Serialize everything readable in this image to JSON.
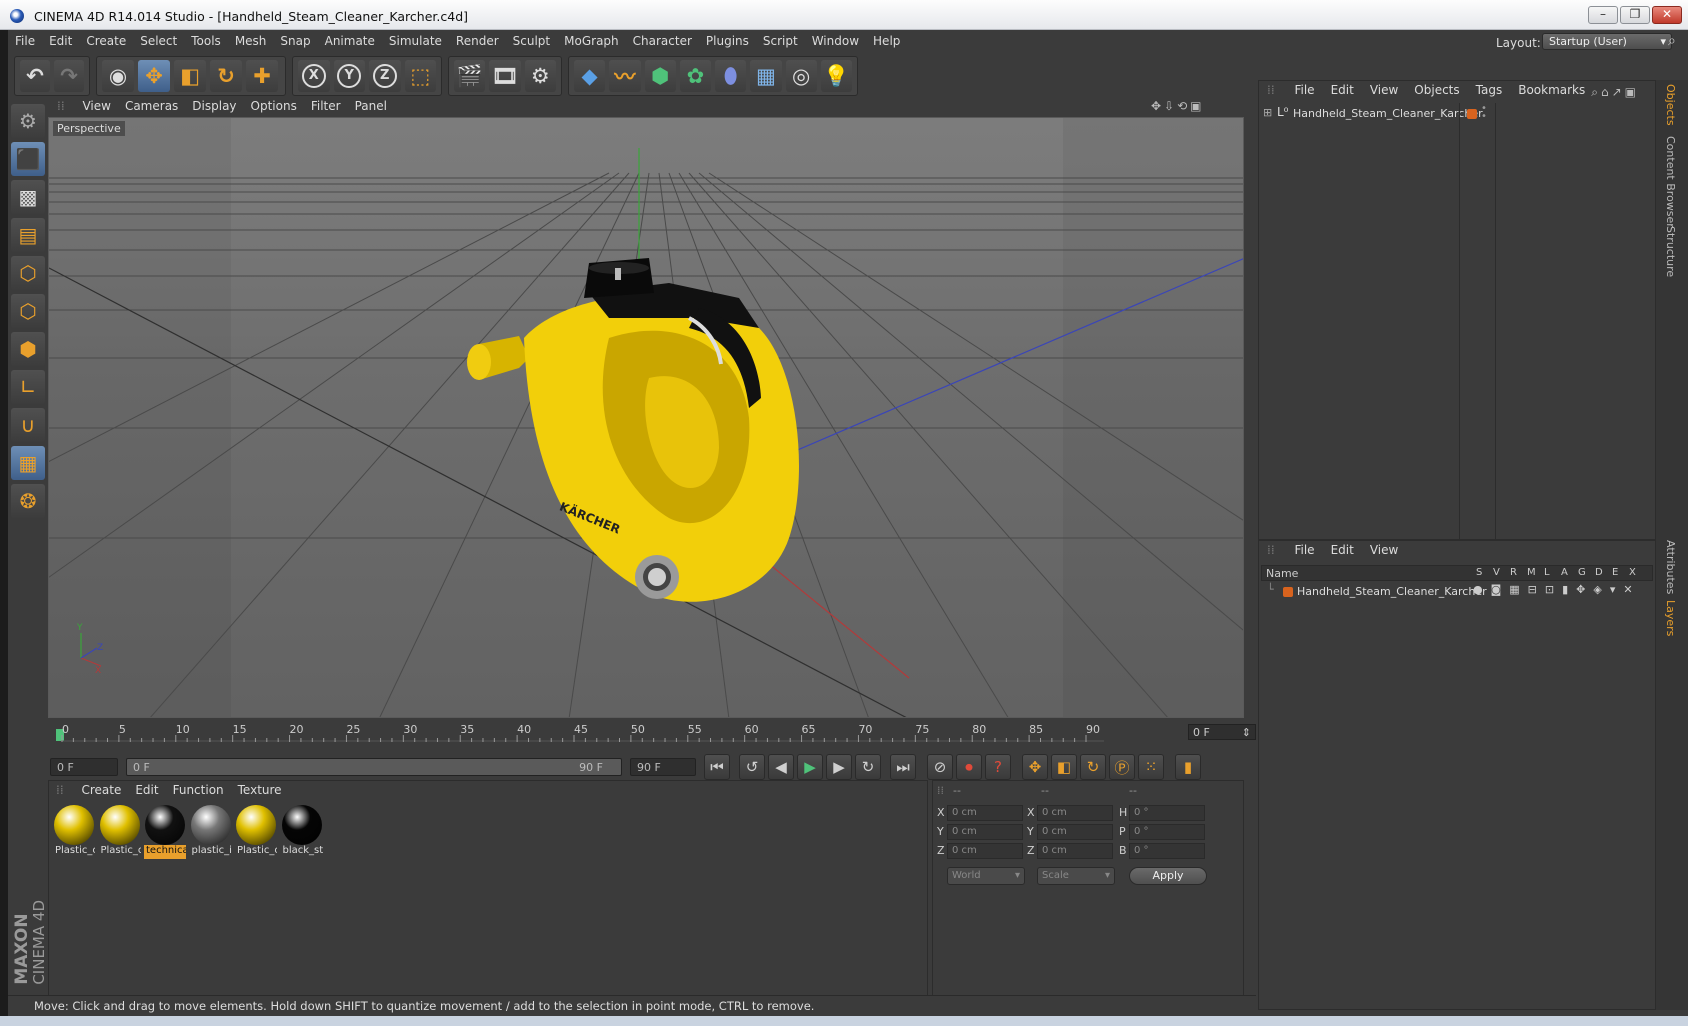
{
  "window": {
    "title": "CINEMA 4D R14.014 Studio - [Handheld_Steam_Cleaner_Karcher.c4d]",
    "buttons": {
      "min": "–",
      "max": "❐",
      "close": "✕"
    }
  },
  "menu": [
    "File",
    "Edit",
    "Create",
    "Select",
    "Tools",
    "Mesh",
    "Snap",
    "Animate",
    "Simulate",
    "Render",
    "Sculpt",
    "MoGraph",
    "Character",
    "Plugins",
    "Script",
    "Window",
    "Help"
  ],
  "layout": {
    "label": "Layout:",
    "value": "Startup (User)"
  },
  "viewport": {
    "menu": [
      "View",
      "Cameras",
      "Display",
      "Options",
      "Filter",
      "Panel"
    ],
    "label": "Perspective",
    "axes": {
      "y": "Y",
      "x": "X",
      "z": "Z"
    },
    "brand_text": "KÄRCHER"
  },
  "timeline": {
    "ticks": [
      "0",
      "5",
      "10",
      "15",
      "20",
      "25",
      "30",
      "35",
      "40",
      "45",
      "50",
      "55",
      "60",
      "65",
      "70",
      "75",
      "80",
      "85",
      "90"
    ],
    "current": "0 F",
    "start": "0 F",
    "range_start": "0 F",
    "range_end": "90 F",
    "end": "90 F"
  },
  "materials": {
    "menu": [
      "Create",
      "Edit",
      "Function",
      "Texture"
    ],
    "items": [
      {
        "name": "Plastic_c",
        "color": "#e0c000",
        "selected": false
      },
      {
        "name": "Plastic_c",
        "color": "#e0c000",
        "selected": false
      },
      {
        "name": "technica",
        "color": "#111111",
        "selected": true
      },
      {
        "name": "plastic_i",
        "color": "#777777",
        "selected": false
      },
      {
        "name": "Plastic_c",
        "color": "#e0c000",
        "selected": false
      },
      {
        "name": "black_st",
        "color": "#050505",
        "selected": false
      }
    ]
  },
  "coords": {
    "headers": [
      "--",
      "--",
      "--"
    ],
    "rows": [
      {
        "a": "X",
        "av": "0 cm",
        "b": "X",
        "bv": "0 cm",
        "c": "H",
        "cv": "0 °"
      },
      {
        "a": "Y",
        "av": "0 cm",
        "b": "Y",
        "bv": "0 cm",
        "c": "P",
        "cv": "0 °"
      },
      {
        "a": "Z",
        "av": "0 cm",
        "b": "Z",
        "bv": "0 cm",
        "c": "B",
        "cv": "0 °"
      }
    ],
    "space": "World",
    "mode": "Scale",
    "apply": "Apply"
  },
  "objects": {
    "menu": [
      "File",
      "Edit",
      "View",
      "Objects",
      "Tags",
      "Bookmarks"
    ],
    "item": "Handheld_Steam_Cleaner_Karcher"
  },
  "layers": {
    "menu": [
      "File",
      "Edit",
      "View"
    ],
    "name_header": "Name",
    "cols": [
      "S",
      "V",
      "R",
      "M",
      "L",
      "A",
      "G",
      "D",
      "E",
      "X"
    ],
    "item": "Handheld_Steam_Cleaner_Karcher"
  },
  "side_tabs": [
    "Objects",
    "Content Browser",
    "Structure",
    "Attributes",
    "Layers"
  ],
  "status": "Move: Click and drag to move elements. Hold down SHIFT to quantize movement / add to the selection in point mode, CTRL to remove.",
  "brand": {
    "line1": "MAXON",
    "line2": "CINEMA 4D"
  },
  "colors": {
    "accent": "#e9a02c",
    "selection_blue": "#5a7fad",
    "object_yellow": "#f2cf0a"
  }
}
